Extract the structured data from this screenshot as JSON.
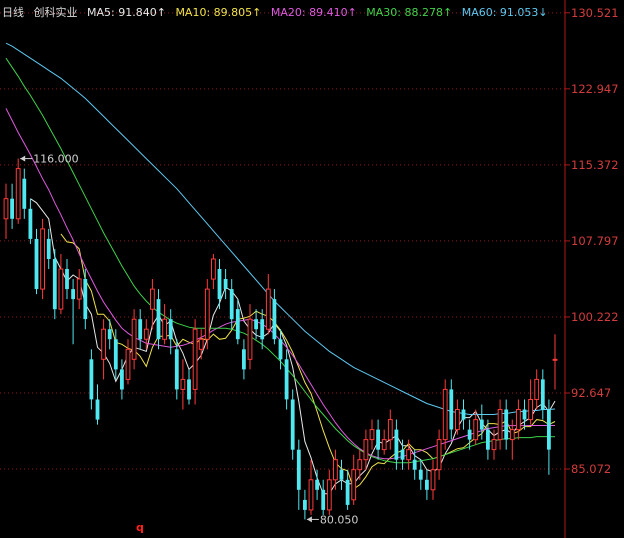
{
  "legend": {
    "period": "日线",
    "name": "创科实业",
    "items": [
      {
        "label": "MA5: 91.840↑",
        "color": "#e8e8e8"
      },
      {
        "label": "MA10: 89.805↑",
        "color": "#f0e24a"
      },
      {
        "label": "MA20: 89.410↑",
        "color": "#e05ae0"
      },
      {
        "label": "MA30: 88.278↑",
        "color": "#3fd24a"
      },
      {
        "label": "MA60: 91.053↓",
        "color": "#5ec8f0"
      }
    ]
  },
  "marker_text": "q",
  "colors": {
    "up": "#ff3b3b",
    "down": "#4fe7f0",
    "axis": "#b01818",
    "grid": "#8a1c1c",
    "tick": "#d23c3c",
    "annotation": "#cfcfcf"
  },
  "chart_data": {
    "type": "candlestick",
    "ylim": [
      78.2,
      131.8
    ],
    "y_ticks": [
      85.072,
      92.647,
      100.222,
      107.797,
      115.372,
      122.947,
      130.521
    ],
    "annotations": [
      {
        "text": "116.000",
        "value": 116.0,
        "index": 2
      },
      {
        "text": "80.050",
        "value": 80.05,
        "index": 49
      }
    ],
    "candles": [
      [
        110,
        112,
        108,
        113.5
      ],
      [
        112,
        110,
        109,
        113.5
      ],
      [
        110,
        115,
        109.5,
        116
      ],
      [
        114,
        111,
        110,
        115
      ],
      [
        111,
        108,
        107.5,
        112
      ],
      [
        108,
        103,
        102.5,
        109
      ],
      [
        103,
        109,
        102,
        110
      ],
      [
        108,
        106,
        105,
        109
      ],
      [
        106,
        101,
        100,
        107
      ],
      [
        101,
        105,
        100.5,
        106.5
      ],
      [
        105,
        103,
        102,
        106
      ],
      [
        103,
        102,
        97.5,
        104
      ],
      [
        102,
        104,
        101,
        105
      ],
      [
        104,
        100,
        99,
        105
      ],
      [
        96,
        92,
        91,
        97
      ],
      [
        92,
        90,
        89.5,
        93.5
      ],
      [
        96,
        99,
        94,
        100
      ],
      [
        99,
        98,
        97,
        100
      ],
      [
        98,
        95,
        94,
        99
      ],
      [
        95,
        93,
        92,
        96
      ],
      [
        94,
        97,
        93.5,
        98
      ],
      [
        96,
        100,
        95,
        101
      ],
      [
        100,
        98,
        97,
        101
      ],
      [
        98,
        99,
        97,
        100
      ],
      [
        101,
        103,
        99,
        104
      ],
      [
        102,
        98,
        97,
        103
      ],
      [
        98,
        100,
        97.5,
        101.5
      ],
      [
        100,
        98,
        96.5,
        101
      ],
      [
        97,
        93,
        92,
        98
      ],
      [
        93,
        94,
        91,
        96
      ],
      [
        94,
        92,
        91.5,
        95
      ],
      [
        93,
        99,
        91.5,
        100
      ],
      [
        97,
        98,
        96,
        99
      ],
      [
        98,
        103,
        97,
        104
      ],
      [
        104,
        106,
        103,
        106.5
      ],
      [
        105,
        102,
        101,
        106
      ],
      [
        104,
        103,
        102,
        105
      ],
      [
        103,
        100,
        99,
        104
      ],
      [
        101,
        98,
        97.5,
        102
      ],
      [
        97,
        95,
        94,
        98
      ],
      [
        96,
        100,
        95,
        101.5
      ],
      [
        100,
        99,
        98,
        101
      ],
      [
        100,
        98,
        97,
        101
      ],
      [
        99,
        103,
        98.5,
        104.5
      ],
      [
        102,
        98,
        97.5,
        103
      ],
      [
        98,
        96,
        95,
        99
      ],
      [
        96,
        92,
        91,
        97
      ],
      [
        92,
        87,
        86,
        93
      ],
      [
        87,
        83,
        81,
        88
      ],
      [
        82,
        81,
        80.05,
        83
      ],
      [
        81,
        84,
        80.5,
        86
      ],
      [
        84,
        83,
        82,
        85
      ],
      [
        83,
        81,
        80.5,
        84
      ],
      [
        81,
        84,
        80.5,
        85
      ],
      [
        84,
        86,
        83,
        87
      ],
      [
        85,
        84,
        83,
        86
      ],
      [
        84,
        81.5,
        81,
        85
      ],
      [
        82,
        85,
        81.5,
        86.5
      ],
      [
        85,
        86,
        84,
        87
      ],
      [
        86,
        88,
        85,
        89
      ],
      [
        88,
        89,
        87,
        90
      ],
      [
        89,
        87,
        86,
        90
      ],
      [
        87,
        88,
        86.5,
        89
      ],
      [
        88,
        90,
        87,
        91
      ],
      [
        89,
        86,
        85,
        90
      ],
      [
        87,
        86,
        85,
        88
      ],
      [
        86,
        87,
        85,
        88
      ],
      [
        86,
        85,
        84,
        87
      ],
      [
        85,
        84,
        83,
        86
      ],
      [
        84,
        83,
        82,
        85
      ],
      [
        83,
        85,
        82,
        86
      ],
      [
        85,
        88,
        84,
        89
      ],
      [
        88,
        93,
        87,
        94
      ],
      [
        93,
        89,
        88,
        94
      ],
      [
        89,
        91,
        88.5,
        92
      ],
      [
        91,
        90,
        89,
        92
      ],
      [
        89,
        88,
        87,
        90
      ],
      [
        88,
        90,
        87.5,
        91
      ],
      [
        90,
        89,
        88,
        91.5
      ],
      [
        89,
        87,
        86,
        90
      ],
      [
        87,
        88,
        86,
        89
      ],
      [
        88,
        91,
        87,
        92
      ],
      [
        91,
        88,
        87,
        92
      ],
      [
        88,
        89,
        86,
        90
      ],
      [
        89,
        91,
        88,
        92
      ],
      [
        91,
        90,
        89,
        92
      ],
      [
        90,
        92,
        89.5,
        94
      ],
      [
        92,
        94,
        91,
        95
      ],
      [
        94,
        91,
        90,
        95
      ],
      [
        91,
        87,
        84.5,
        92
      ],
      [
        96,
        96,
        93,
        98.5
      ]
    ],
    "ma": {
      "MA5": [
        null,
        null,
        null,
        null,
        112,
        111.6,
        110.8,
        110,
        106.2,
        105,
        103.8,
        104.4,
        104,
        101.5,
        100.5,
        97.2,
        96.6,
        95.6,
        93.8,
        95,
        96.4,
        97.2,
        97,
        96.8,
        99.4,
        100.4,
        99.4,
        99.8,
        97.8,
        96.6,
        95,
        95.6,
        96.4,
        98,
        100.4,
        101.6,
        103.2,
        102.8,
        102,
        99.8,
        99,
        98.4,
        98.2,
        98.6,
        99.6,
        98.8,
        97.4,
        95.2,
        91.8,
        87.8,
        86.2,
        84.2,
        82.6,
        82.6,
        83.6,
        84,
        83.6,
        83.6,
        84.4,
        85,
        86.6,
        87.8,
        87.6,
        88,
        88.4,
        87.4,
        87.4,
        86.4,
        86,
        85,
        84.8,
        85.2,
        86.6,
        87.6,
        89.2,
        90.2,
        90.2,
        90.8,
        89.6,
        89,
        88.4,
        88.8,
        89,
        88.6,
        89.4,
        89.8,
        90.2,
        91.2,
        91.6,
        90.8,
        91.84
      ],
      "MA10": [
        null,
        null,
        null,
        null,
        null,
        null,
        null,
        null,
        null,
        108.5,
        107.7,
        107.6,
        107,
        103.9,
        102.8,
        100.5,
        100.5,
        99.8,
        97.7,
        97.5,
        97.1,
        96.9,
        96.3,
        95.3,
        97.2,
        98.3,
        98.3,
        98.4,
        97.3,
        98,
        97.7,
        97.5,
        98.1,
        97.9,
        98.5,
        98,
        98.1,
        98.9,
        100,
        100.1,
        100.3,
        100.8,
        100.5,
        100.3,
        99.7,
        98.9,
        97.9,
        96.7,
        95.2,
        93.7,
        92.6,
        90.8,
        88.9,
        87.2,
        85.7,
        85.1,
        84.9,
        83.1,
        83.5,
        84.3,
        85.3,
        85.7,
        85.6,
        86.2,
        86.7,
        86.9,
        87.6,
        87,
        87,
        86.7,
        86.1,
        86.3,
        86.5,
        86.8,
        87.1,
        87.2,
        87.7,
        88.2,
        88.6,
        89.6,
        89.6,
        89.5,
        89.9,
        88.6,
        88.8,
        89.3,
        89.3,
        90,
        89.9,
        89.5,
        89.805
      ],
      "MA20": [
        121,
        119.8,
        118.6,
        117.5,
        116.4,
        115.2,
        114,
        112.9,
        111.6,
        110.4,
        109.1,
        107.9,
        106.5,
        105.2,
        104,
        102.8,
        101.7,
        100.8,
        99.9,
        99.1,
        98.6,
        98.2,
        97.9,
        97.6,
        97.5,
        97.4,
        97.3,
        97.2,
        97.3,
        97.4,
        97.6,
        97.9,
        98.2,
        98.5,
        98.9,
        99.2,
        99.5,
        99.7,
        99.8,
        99.9,
        100,
        99.8,
        99.5,
        99.1,
        98.5,
        97.9,
        97.2,
        96.4,
        95.5,
        94.5,
        93.5,
        92.5,
        91.5,
        90.6,
        89.7,
        88.9,
        88.2,
        87.6,
        87.1,
        86.7,
        86.4,
        86.2,
        86.1,
        86.1,
        86.2,
        86.3,
        86.5,
        86.7,
        86.9,
        87.1,
        87.3,
        87.5,
        87.7,
        87.9,
        88.1,
        88.3,
        88.5,
        88.7,
        88.9,
        89.1,
        89.2,
        89.3,
        89.4,
        89.4,
        89.4,
        89.4,
        89.41,
        89.41,
        89.41,
        89.41,
        89.41
      ],
      "MA30": [
        126,
        125.1,
        124.2,
        123.2,
        122.3,
        121.3,
        120.3,
        119.2,
        118.1,
        117,
        115.8,
        114.6,
        113.4,
        112.2,
        111,
        109.8,
        108.6,
        107.5,
        106.4,
        105.3,
        104.3,
        103.3,
        102.5,
        101.8,
        101.2,
        100.7,
        100.3,
        99.9,
        99.6,
        99.4,
        99.2,
        99.1,
        99.1,
        99.1,
        99.1,
        99.1,
        99.1,
        99,
        98.8,
        98.6,
        98.3,
        97.9,
        97.5,
        97,
        96.4,
        95.8,
        95.1,
        94.4,
        93.6,
        92.8,
        92,
        91.2,
        90.5,
        89.8,
        89.1,
        88.5,
        87.9,
        87.4,
        87,
        86.6,
        86.3,
        86.1,
        85.9,
        85.8,
        85.7,
        85.7,
        85.7,
        85.8,
        85.9,
        86,
        86.1,
        86.3,
        86.5,
        86.7,
        86.9,
        87.1,
        87.3,
        87.5,
        87.7,
        87.8,
        87.9,
        88,
        88.1,
        88.1,
        88.2,
        88.2,
        88.2,
        88.3,
        88.3,
        88.3,
        88.278
      ],
      "MA60": [
        127.5,
        127.2,
        126.8,
        126.4,
        126,
        125.6,
        125.2,
        124.8,
        124.4,
        124,
        123.5,
        123,
        122.5,
        122,
        121.4,
        120.8,
        120.2,
        119.6,
        119,
        118.4,
        117.8,
        117.2,
        116.6,
        116,
        115.4,
        114.8,
        114.2,
        113.6,
        113,
        112.3,
        111.6,
        110.9,
        110.2,
        109.5,
        108.8,
        108.1,
        107.4,
        106.7,
        106,
        105.3,
        104.6,
        103.9,
        103.2,
        102.5,
        101.8,
        101.2,
        100.6,
        100,
        99.4,
        98.8,
        98.3,
        97.8,
        97.3,
        96.8,
        96.4,
        96,
        95.6,
        95.2,
        94.9,
        94.6,
        94.3,
        94,
        93.7,
        93.4,
        93.1,
        92.8,
        92.5,
        92.2,
        91.9,
        91.6,
        91.4,
        91.2,
        91,
        90.8,
        90.7,
        90.6,
        90.5,
        90.5,
        90.5,
        90.5,
        90.5,
        90.6,
        90.6,
        90.7,
        90.8,
        90.8,
        90.9,
        90.9,
        91,
        91,
        91.053
      ]
    }
  }
}
